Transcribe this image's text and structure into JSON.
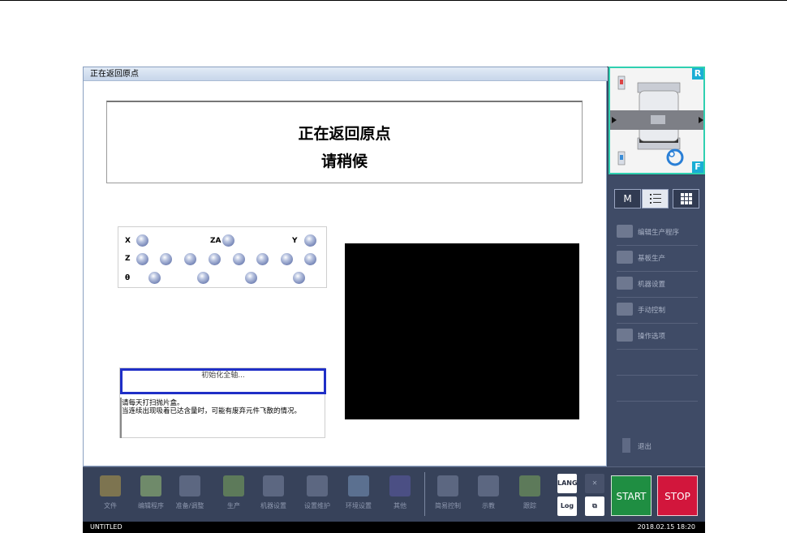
{
  "dialog": {
    "title": "正在返回原点",
    "message_line1": "正在返回原点",
    "message_line2": "请稍候"
  },
  "axes": {
    "row1": [
      {
        "label": "X"
      },
      {
        "label": "ZA"
      },
      {
        "label": "Y"
      }
    ],
    "row2_label": "Z",
    "row2_count": 8,
    "row3_label": "θ",
    "row3_count": 4
  },
  "status": {
    "current": "初始化全轴...",
    "log": "请每天打扫抛片盒。\n当连续出现吸着已达含量时，可能有废弃元件飞散的情况。"
  },
  "machine_panel": {
    "rear_tag": "R",
    "front_tag": "F"
  },
  "right_menu": {
    "modes": [
      {
        "icon": "manual-mode-icon",
        "label": "M"
      },
      {
        "icon": "list-mode-icon",
        "label": ""
      },
      {
        "icon": "grid-mode-icon",
        "label": ""
      }
    ],
    "items": [
      {
        "label": "编辑生产程序",
        "icon": "edit-program-icon"
      },
      {
        "label": "基板生产",
        "icon": "production-icon"
      },
      {
        "label": "机器设置",
        "icon": "machine-settings-icon"
      },
      {
        "label": "手动控制",
        "icon": "manual-control-icon"
      },
      {
        "label": "操作选项",
        "icon": "options-icon"
      },
      {
        "label": "",
        "icon": ""
      },
      {
        "label": "",
        "icon": ""
      }
    ],
    "exit_label": "退出"
  },
  "toolbar": {
    "items": [
      {
        "label": "文件",
        "icon": "folder-icon"
      },
      {
        "label": "编辑程序",
        "icon": "edit-icon"
      },
      {
        "label": "准备/调整",
        "icon": "prepare-icon"
      },
      {
        "label": "生产",
        "icon": "production-icon"
      },
      {
        "label": "机器设置",
        "icon": "machine-icon"
      },
      {
        "label": "设置维护",
        "icon": "maintenance-icon"
      },
      {
        "label": "环境设置",
        "icon": "environment-icon"
      },
      {
        "label": "其他",
        "icon": "book-icon"
      },
      {
        "label": "简易控制",
        "icon": "simple-control-icon"
      },
      {
        "label": "示教",
        "icon": "teach-icon"
      },
      {
        "label": "跟踪",
        "icon": "trace-icon"
      }
    ],
    "lang_label": "LANG",
    "log_label": "Log",
    "start_label": "START",
    "stop_label": "STOP"
  },
  "statusbar": {
    "file": "UNTITLED",
    "datetime": "2018.02.15 18:20"
  }
}
